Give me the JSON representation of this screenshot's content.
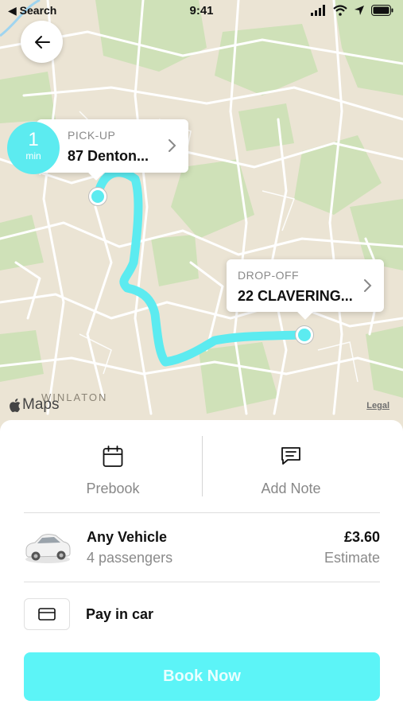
{
  "status_bar": {
    "back_app": "◀ Search",
    "time": "9:41"
  },
  "map": {
    "eta": {
      "value": "1",
      "unit": "min"
    },
    "pickup": {
      "label": "PICK-UP",
      "address": "87 Denton..."
    },
    "dropoff": {
      "label": "DROP-OFF",
      "address": "22 CLAVERING..."
    },
    "area_label": "WINLATON",
    "maps_brand": "Maps",
    "legal": "Legal",
    "route_color": "#5cebf0"
  },
  "actions": {
    "prebook": "Prebook",
    "add_note": "Add Note"
  },
  "vehicle": {
    "name": "Any Vehicle",
    "passengers": "4 passengers",
    "price": "£3.60",
    "price_note": "Estimate"
  },
  "payment": {
    "label": "Pay in car"
  },
  "book_button": {
    "label": "Book Now",
    "color": "#5cf4f7"
  }
}
